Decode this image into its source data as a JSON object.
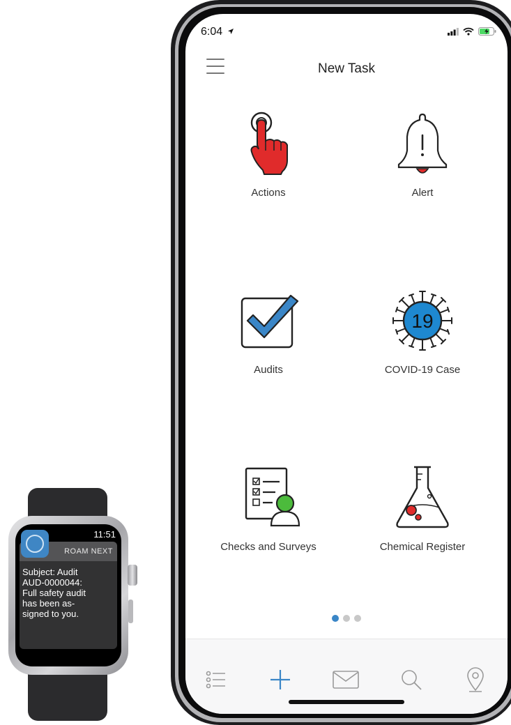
{
  "watch": {
    "time": "11:51",
    "app_name": "ROAM NEXT",
    "message_lines": [
      "Subject: Audit",
      "AUD-0000044:",
      "Full safety audit",
      "has been as-",
      "signed to you."
    ]
  },
  "phone": {
    "status_time": "6:04",
    "title": "New Task",
    "tiles": [
      {
        "label": "Actions",
        "icon": "pointing-hand-icon"
      },
      {
        "label": "Alert",
        "icon": "bell-icon"
      },
      {
        "label": "Audits",
        "icon": "checkbox-icon"
      },
      {
        "label": "COVID-19 Case",
        "icon": "virus-icon",
        "badge": "19"
      },
      {
        "label": "Checks and Surveys",
        "icon": "checklist-person-icon"
      },
      {
        "label": "Chemical Register",
        "icon": "flask-icon"
      }
    ],
    "page_dots": {
      "count": 3,
      "active_index": 0
    },
    "tabs": [
      "list-icon",
      "plus-icon",
      "mail-icon",
      "search-icon",
      "location-pin-icon"
    ],
    "colors": {
      "accent": "#3a86c7",
      "red": "#e02b2b",
      "green": "#4cbb3c",
      "virus_blue": "#1e88d0"
    }
  }
}
